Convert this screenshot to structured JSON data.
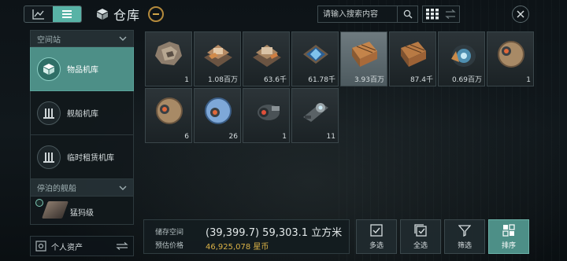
{
  "header": {
    "title": "仓库",
    "search": {
      "placeholder": "请输入搜索内容",
      "value": ""
    }
  },
  "sidebar": {
    "station_header": "空间站",
    "items": [
      {
        "label": "物品机库",
        "active": true
      },
      {
        "label": "舰船机库",
        "active": false
      },
      {
        "label": "临时租赁机库",
        "active": false
      }
    ],
    "docked_header": "停泊的舰船",
    "ship_label": "猛犸级",
    "personal_assets": "个人资产"
  },
  "items": [
    {
      "qty": "1",
      "icon": "ore-chunk-icon"
    },
    {
      "qty": "1.08百万",
      "icon": "component-block-icon"
    },
    {
      "qty": "63.6千",
      "icon": "component-block-icon"
    },
    {
      "qty": "61.78千",
      "icon": "blue-chip-icon"
    },
    {
      "qty": "3.93百万",
      "icon": "cargo-crate-icon"
    },
    {
      "qty": "87.4千",
      "icon": "cargo-crate-icon"
    },
    {
      "qty": "0.69百万",
      "icon": "blue-module-icon"
    },
    {
      "qty": "1",
      "icon": "sphere-module-icon"
    },
    {
      "qty": "6",
      "icon": "sphere-module-icon"
    },
    {
      "qty": "26",
      "icon": "blue-sphere-icon"
    },
    {
      "qty": "1",
      "icon": "drone-icon"
    },
    {
      "qty": "11",
      "icon": "turret-icon"
    }
  ],
  "storage": {
    "space_label": "储存空间",
    "space_value": "(39,399.7) 59,303.1 立方米",
    "price_label": "预估价格",
    "price_value": "46,925,078 星币"
  },
  "actions": {
    "multi_select": "多选",
    "select_all": "全选",
    "filter": "筛选",
    "sort": "排序"
  },
  "colors": {
    "accent": "#58b3a6",
    "gold": "#d9b146",
    "highlight_tile": "#6e7a7f"
  }
}
